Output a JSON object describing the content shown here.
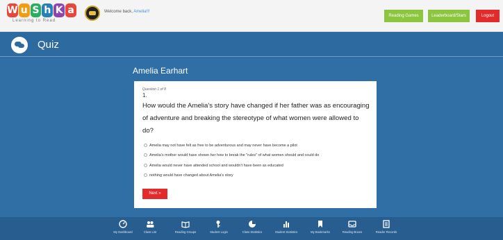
{
  "header": {
    "logo_letters": [
      "W",
      "u",
      "S",
      "h",
      "K",
      "a"
    ],
    "logo_colors": [
      "#e8463a",
      "#f39c12",
      "#27ae60",
      "#2980b9",
      "#8e44ad",
      "#e8463a"
    ],
    "logo_tagline": "Learning to Read",
    "welcome_text": "Welcome back,",
    "welcome_user": "Amelia!!!",
    "buttons": [
      {
        "label": "Reading Games",
        "color": "#8cc63f"
      },
      {
        "label": "Leaderboard/Stars",
        "color": "#8cc63f"
      },
      {
        "label": "Logout",
        "color": "#e42b2b"
      }
    ]
  },
  "quiz_band": {
    "title": "Quiz",
    "icon": "speech-bubbles-icon"
  },
  "main": {
    "story_title": "Amelia Earhart",
    "question_counter": "Question 1 of 8",
    "question_number": "1.",
    "question_text": "How would the Amelia's story have changed if her father was as encouraging of adventure and breaking the stereotype of what women were allowed to do?",
    "options": [
      "Amelia may not have felt as free to be adventurous and may never have become a pilot",
      "Amelia's mother would have shown her how to break the \"rules\" of what women should and could do",
      "Amelia would never have attended school and wouldn't have been as educated",
      "nothing would have changed about Amelia's story"
    ],
    "next_label": "Next »"
  },
  "bottom_nav": [
    {
      "label": "My Dashboard",
      "icon": "dashboard-icon"
    },
    {
      "label": "Class List",
      "icon": "users-icon"
    },
    {
      "label": "Reading Groups",
      "icon": "book-open-icon"
    },
    {
      "label": "Student Login",
      "icon": "key-icon"
    },
    {
      "label": "Class Statistics",
      "icon": "pie-chart-icon"
    },
    {
      "label": "Student Statistics",
      "icon": "bar-chart-icon"
    },
    {
      "label": "My Bookmarks",
      "icon": "bookmark-icon"
    },
    {
      "label": "Reading Boxes",
      "icon": "inbox-icon"
    },
    {
      "label": "Reader Records",
      "icon": "records-icon"
    }
  ]
}
